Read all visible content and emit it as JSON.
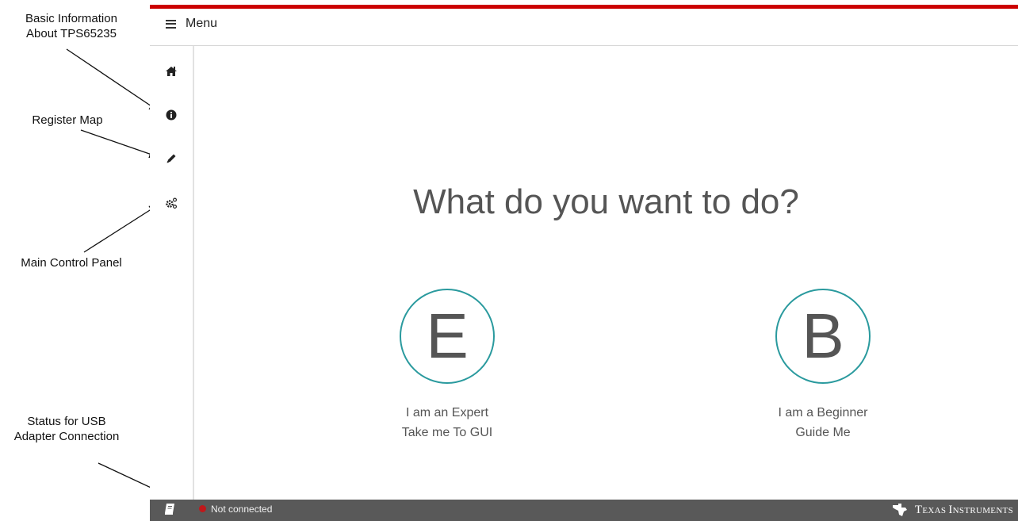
{
  "annotations": {
    "basic_info": "Basic Information\nAbout TPS65235",
    "register_map": "Register Map",
    "main_control": "Main Control Panel",
    "usb_status": "Status for USB\nAdapter Connection"
  },
  "header": {
    "menu_label": "Menu"
  },
  "sidebar": {
    "icons": [
      "home-icon",
      "info-icon",
      "pencil-icon",
      "gears-icon"
    ]
  },
  "main": {
    "question": "What do you want to do?",
    "choices": [
      {
        "letter": "E",
        "line1": "I am an Expert",
        "line2": "Take me To GUI"
      },
      {
        "letter": "B",
        "line1": "I am a Beginner",
        "line2": "Guide Me"
      }
    ]
  },
  "status": {
    "connection_text": "Not connected",
    "connection_color": "#c0181b"
  },
  "brand": {
    "name": "Texas Instruments",
    "accent_color": "#cc0000",
    "circle_color": "#2a9a9e"
  }
}
